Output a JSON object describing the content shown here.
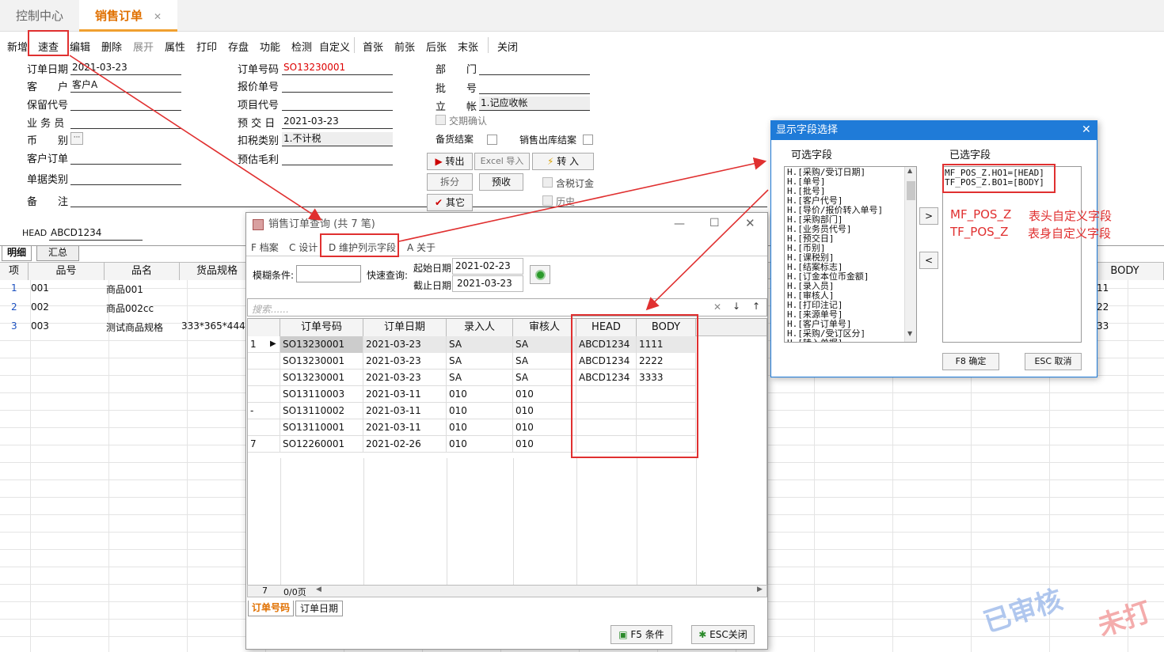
{
  "tabs": {
    "control_center": "控制中心",
    "sales_order": "销售订单",
    "close": "✕"
  },
  "toolbar": [
    "新增",
    "速查",
    "编辑",
    "删除",
    "展开",
    "属性",
    "打印",
    "存盘",
    "功能",
    "检测",
    "自定义",
    "首张",
    "前张",
    "后张",
    "末张",
    "关闭"
  ],
  "form": {
    "order_date_label": "订单日期",
    "order_date": "2021-03-23",
    "customer_label": "客　　户",
    "customer": "客户A",
    "warranty_label": "保留代号",
    "salesman_label": "业 务 员",
    "currency_label": "币　　别",
    "currency_btn": "···",
    "customer_order_label": "客户订单",
    "doc_type_label": "单据类别",
    "remark_label": "备　　注",
    "order_no_label": "订单号码",
    "order_no": "SO13230001",
    "quote_no_label": "报价单号",
    "project_no_label": "项目代号",
    "delivery_date_label": "预 交 日",
    "delivery_date": "2021-03-23",
    "tax_type_label": "扣税类别",
    "tax_type": "1.不计税",
    "est_margin_label": "预估毛利",
    "dept_label": "部　　门",
    "batch_label": "批　　号",
    "account_label": "立　　帐",
    "account": "1.记应收帐",
    "delivery_confirm": "交期确认",
    "stock_close": "备货结案",
    "sales_close": "销售出库结案",
    "btn_export": "转出",
    "btn_excel": "Excel 导入",
    "btn_transfer": "转 入",
    "btn_split": "拆分",
    "btn_prepay": "预收",
    "incl_tax": "含税订金",
    "btn_other": "其它",
    "history": "历史",
    "head_label": "HEAD",
    "head_value": "ABCD1234"
  },
  "detail": {
    "tab_detail": "明细",
    "tab_summary": "汇总",
    "headers": [
      "项",
      "品号",
      "品名",
      "货品规格"
    ],
    "body_header": "BODY",
    "rows": [
      {
        "n": "1",
        "code": "001",
        "name": "商品001",
        "spec": "",
        "body": "11"
      },
      {
        "n": "2",
        "code": "002",
        "name": "商品002cc",
        "spec": "",
        "body": "22"
      },
      {
        "n": "3",
        "code": "003",
        "name": "测试商品规格",
        "spec": "333*365*444",
        "body": "33"
      }
    ]
  },
  "query": {
    "title": "销售订单查询 (共 7 笔)",
    "menu": [
      "F 档案",
      "C 设计",
      "D 维护列示字段",
      "A 关于"
    ],
    "fuzzy_label": "模糊条件:",
    "quick_label": "快速查询:",
    "start_label": "起始日期",
    "start_date": "2021-02-23",
    "end_label": "截止日期",
    "end_date": "2021-03-23",
    "search_placeholder": "搜索......",
    "columns": [
      "订单号码",
      "订单日期",
      "录入人",
      "审核人",
      "HEAD",
      "BODY"
    ],
    "rows": [
      {
        "ind": "1",
        "no": "SO13230001",
        "date": "2021-03-23",
        "entry": "SA",
        "audit": "SA",
        "head": "ABCD1234",
        "body": "1111"
      },
      {
        "ind": "",
        "no": "SO13230001",
        "date": "2021-03-23",
        "entry": "SA",
        "audit": "SA",
        "head": "ABCD1234",
        "body": "2222"
      },
      {
        "ind": "",
        "no": "SO13230001",
        "date": "2021-03-23",
        "entry": "SA",
        "audit": "SA",
        "head": "ABCD1234",
        "body": "3333"
      },
      {
        "ind": "",
        "no": "SO13110003",
        "date": "2021-03-11",
        "entry": "010",
        "audit": "010",
        "head": "",
        "body": ""
      },
      {
        "ind": "-",
        "no": "SO13110002",
        "date": "2021-03-11",
        "entry": "010",
        "audit": "010",
        "head": "",
        "body": ""
      },
      {
        "ind": "",
        "no": "SO13110001",
        "date": "2021-03-11",
        "entry": "010",
        "audit": "010",
        "head": "",
        "body": ""
      },
      {
        "ind": "7",
        "no": "SO12260001",
        "date": "2021-02-26",
        "entry": "010",
        "audit": "010",
        "head": "",
        "body": ""
      }
    ],
    "footer_count": "7",
    "footer_page": "0/0页",
    "sort_tabs": [
      "订单号码",
      "订单日期"
    ],
    "btn_f5": "F5 条件",
    "btn_esc": "ESC关闭"
  },
  "field_dialog": {
    "title": "显示字段选择",
    "available_label": "可选字段",
    "selected_label": "已选字段",
    "available": [
      "H.[采购/受订日期]",
      "H.[单号]",
      "H.[批号]",
      "H.[客户代号]",
      "H.[导价/报价转入单号]",
      "H.[采购部门]",
      "H.[业务员代号]",
      "H.[预交日]",
      "H.[币别]",
      "H.[课税别]",
      "H.[结案标志]",
      "H.[订金本位币金额]",
      "H.[录入员]",
      "H.[审核人]",
      "H.[打印注记]",
      "H.[来源单号]",
      "H.[客户订单号]",
      "H.[采购/受订区分]",
      "H.[转入单据]"
    ],
    "selected": [
      "MF_POS_Z.HO1=[HEAD]",
      "TF_POS_Z.BO1=[BODY]"
    ],
    "btn_add": ">",
    "btn_remove": "<",
    "btn_ok": "F8 确定",
    "btn_cancel": "ESC 取消"
  },
  "annotations": {
    "mf": "MF_POS_Z",
    "mf_desc": "表头自定义字段",
    "tf": "TF_POS_Z",
    "tf_desc": "表身自定义字段"
  },
  "stamps": {
    "audited": "已审核",
    "unprinted": "未打"
  },
  "colors": {
    "accent": "#e07000",
    "red_box": "#e03030",
    "blue_title": "#1f7bd8"
  }
}
